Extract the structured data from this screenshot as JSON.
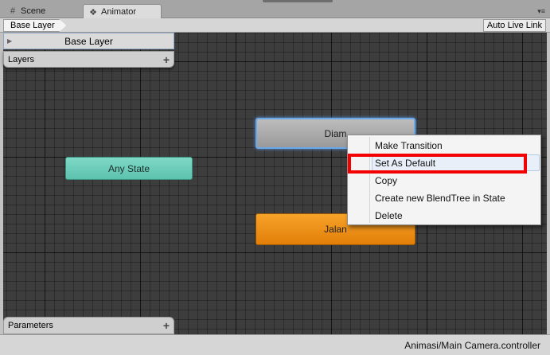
{
  "tabs": [
    {
      "label": "Scene",
      "icon": "grid-icon"
    },
    {
      "label": "Animator",
      "icon": "animator-icon"
    }
  ],
  "toolbar": {
    "breadcrumb": "Base Layer",
    "auto_live_link": "Auto Live Link"
  },
  "panels": {
    "base_layer": "Base Layer",
    "layers": "Layers",
    "parameters": "Parameters",
    "add_symbol": "+"
  },
  "states": {
    "any_state": "Any State",
    "diam": "Diam",
    "jalan": "Jalan"
  },
  "context_menu": {
    "items": [
      "Make Transition",
      "Set As Default",
      "Copy",
      "Create new BlendTree in State",
      "Delete"
    ]
  },
  "status": {
    "controller_path": "Animasi/Main Camera.controller"
  },
  "colors": {
    "any_state": "#6fcfbb",
    "default_state": "#f08f18",
    "selection": "#6aa8e8",
    "annotation": "#f30000"
  }
}
